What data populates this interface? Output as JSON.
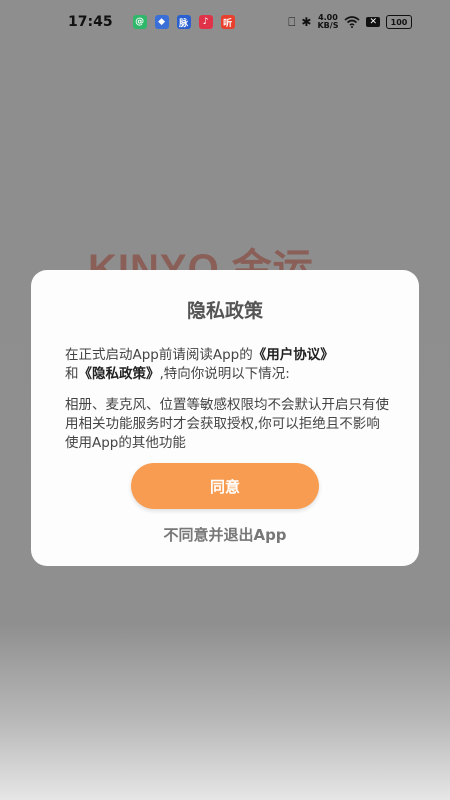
{
  "status_bar": {
    "time": "17:45",
    "notif_icons": [
      "app-green",
      "app-blue",
      "app-mai",
      "app-music",
      "app-ting"
    ],
    "notif_labels": [
      "@",
      "◆",
      "脉",
      "♪",
      "听"
    ],
    "notif_colors": [
      "#2fb86a",
      "#3b6fd8",
      "#2a5fd0",
      "#e0334a",
      "#e8402c"
    ],
    "network_speed_value": "4.00",
    "network_speed_unit": "KB/S",
    "battery": "100"
  },
  "background": {
    "logo_text": "KINYO 金运"
  },
  "dialog": {
    "title": "隐私政策",
    "p1_prefix": "在正式启动App前请阅读App的",
    "user_agreement_link": "《用户协议》",
    "p1_and": "和",
    "privacy_policy_link": "《隐私政策》",
    "p1_suffix": ",特向你说明以下情况:",
    "p2": "相册、麦克风、位置等敏感权限均不会默认开启只有使用相关功能服务时才会获取授权,你可以拒绝且不影响使用App的其他功能",
    "agree_label": "同意",
    "disagree_label": "不同意并退出App"
  },
  "colors": {
    "accent": "#f79c50",
    "overlay": "#8f8f8f",
    "logo": "#8a5d56"
  }
}
